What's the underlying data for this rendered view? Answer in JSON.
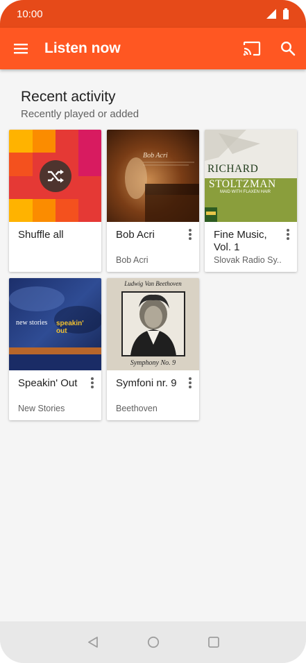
{
  "status_bar": {
    "time": "10:00"
  },
  "app_bar": {
    "title": "Listen now",
    "menu_icon": "hamburger-menu-icon",
    "cast_icon": "cast-icon",
    "search_icon": "search-icon"
  },
  "section": {
    "title": "Recent activity",
    "subtitle": "Recently played or added"
  },
  "cards": [
    {
      "title": "Shuffle all",
      "subtitle": ""
    },
    {
      "title": "Bob Acri",
      "subtitle": "Bob Acri"
    },
    {
      "title": "Fine Music, Vol. 1",
      "subtitle": "Slovak Radio Sy.."
    },
    {
      "title": "Speakin' Out",
      "subtitle": "New Stories"
    },
    {
      "title": "Symfoni nr. 9",
      "subtitle": "Beethoven"
    }
  ],
  "album_art_text": {
    "richard": "RICHARD",
    "stoltzman": "STOLTZMAN",
    "maid": "MAID WITH FLAXEN HAIR",
    "new_stories": "new stories",
    "speakin_out": "speakin' out",
    "ludwig": "Ludwig Van Beethoven",
    "symphony": "Symphony No. 9"
  },
  "colors": {
    "status_bar": "#e64a19",
    "app_bar": "#ff5722",
    "background": "#f5f5f5"
  }
}
